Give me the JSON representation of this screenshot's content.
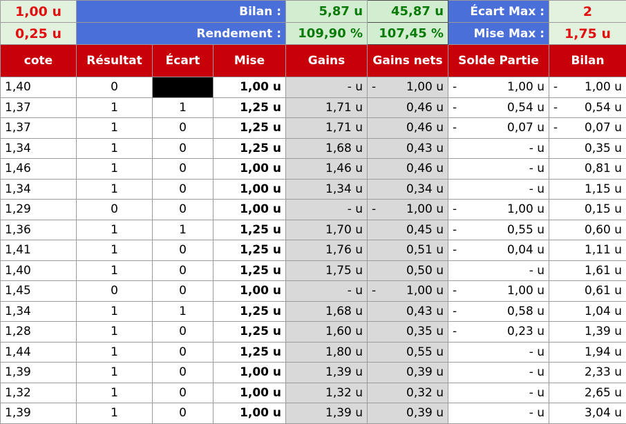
{
  "summary": {
    "left_top": "1,00 u",
    "left_bottom": "0,25 u",
    "bilan_label": "Bilan :",
    "rendement_label": "Rendement :",
    "bilan_value1": "5,87 u",
    "bilan_value2": "45,87 u",
    "rendement_value1": "109,90 %",
    "rendement_value2": "107,45 %",
    "ecart_max_label": "Écart Max :",
    "mise_max_label": "Mise Max :",
    "ecart_max_value": "2",
    "mise_max_value": "1,75 u"
  },
  "headers": [
    "cote",
    "Résultat",
    "Écart",
    "Mise",
    "Gains",
    "Gains nets",
    "Solde Partie",
    "Bilan"
  ],
  "rows": [
    {
      "cote": "1,40",
      "res": "0",
      "ecart": "",
      "mise": "1,00 u",
      "gains": "- u",
      "gn_sign": "-",
      "gn": "1,00 u",
      "sp_sign": "-",
      "sp": "1,00 u",
      "b_sign": "-",
      "bilan": "1,00 u"
    },
    {
      "cote": "1,37",
      "res": "1",
      "ecart": "1",
      "mise": "1,25 u",
      "gains": "1,71 u",
      "gn_sign": "",
      "gn": "0,46 u",
      "sp_sign": "-",
      "sp": "0,54 u",
      "b_sign": "-",
      "bilan": "0,54 u"
    },
    {
      "cote": "1,37",
      "res": "1",
      "ecart": "0",
      "mise": "1,25 u",
      "gains": "1,71 u",
      "gn_sign": "",
      "gn": "0,46 u",
      "sp_sign": "-",
      "sp": "0,07 u",
      "b_sign": "-",
      "bilan": "0,07 u"
    },
    {
      "cote": "1,34",
      "res": "1",
      "ecart": "0",
      "mise": "1,25 u",
      "gains": "1,68 u",
      "gn_sign": "",
      "gn": "0,43 u",
      "sp_sign": "",
      "sp": "- u",
      "b_sign": "",
      "bilan": "0,35 u"
    },
    {
      "cote": "1,46",
      "res": "1",
      "ecart": "0",
      "mise": "1,00 u",
      "gains": "1,46 u",
      "gn_sign": "",
      "gn": "0,46 u",
      "sp_sign": "",
      "sp": "- u",
      "b_sign": "",
      "bilan": "0,81 u"
    },
    {
      "cote": "1,34",
      "res": "1",
      "ecart": "0",
      "mise": "1,00 u",
      "gains": "1,34 u",
      "gn_sign": "",
      "gn": "0,34 u",
      "sp_sign": "",
      "sp": "- u",
      "b_sign": "",
      "bilan": "1,15 u"
    },
    {
      "cote": "1,29",
      "res": "0",
      "ecart": "0",
      "mise": "1,00 u",
      "gains": "- u",
      "gn_sign": "-",
      "gn": "1,00 u",
      "sp_sign": "-",
      "sp": "1,00 u",
      "b_sign": "",
      "bilan": "0,15 u"
    },
    {
      "cote": "1,36",
      "res": "1",
      "ecart": "1",
      "mise": "1,25 u",
      "gains": "1,70 u",
      "gn_sign": "",
      "gn": "0,45 u",
      "sp_sign": "-",
      "sp": "0,55 u",
      "b_sign": "",
      "bilan": "0,60 u"
    },
    {
      "cote": "1,41",
      "res": "1",
      "ecart": "0",
      "mise": "1,25 u",
      "gains": "1,76 u",
      "gn_sign": "",
      "gn": "0,51 u",
      "sp_sign": "-",
      "sp": "0,04 u",
      "b_sign": "",
      "bilan": "1,11 u"
    },
    {
      "cote": "1,40",
      "res": "1",
      "ecart": "0",
      "mise": "1,25 u",
      "gains": "1,75 u",
      "gn_sign": "",
      "gn": "0,50 u",
      "sp_sign": "",
      "sp": "- u",
      "b_sign": "",
      "bilan": "1,61 u"
    },
    {
      "cote": "1,45",
      "res": "0",
      "ecart": "0",
      "mise": "1,00 u",
      "gains": "- u",
      "gn_sign": "-",
      "gn": "1,00 u",
      "sp_sign": "-",
      "sp": "1,00 u",
      "b_sign": "",
      "bilan": "0,61 u"
    },
    {
      "cote": "1,34",
      "res": "1",
      "ecart": "1",
      "mise": "1,25 u",
      "gains": "1,68 u",
      "gn_sign": "",
      "gn": "0,43 u",
      "sp_sign": "-",
      "sp": "0,58 u",
      "b_sign": "",
      "bilan": "1,04 u"
    },
    {
      "cote": "1,28",
      "res": "1",
      "ecart": "0",
      "mise": "1,25 u",
      "gains": "1,60 u",
      "gn_sign": "",
      "gn": "0,35 u",
      "sp_sign": "-",
      "sp": "0,23 u",
      "b_sign": "",
      "bilan": "1,39 u"
    },
    {
      "cote": "1,44",
      "res": "1",
      "ecart": "0",
      "mise": "1,25 u",
      "gains": "1,80 u",
      "gn_sign": "",
      "gn": "0,55 u",
      "sp_sign": "",
      "sp": "- u",
      "b_sign": "",
      "bilan": "1,94 u"
    },
    {
      "cote": "1,39",
      "res": "1",
      "ecart": "0",
      "mise": "1,00 u",
      "gains": "1,39 u",
      "gn_sign": "",
      "gn": "0,39 u",
      "sp_sign": "",
      "sp": "- u",
      "b_sign": "",
      "bilan": "2,33 u"
    },
    {
      "cote": "1,32",
      "res": "1",
      "ecart": "0",
      "mise": "1,00 u",
      "gains": "1,32 u",
      "gn_sign": "",
      "gn": "0,32 u",
      "sp_sign": "",
      "sp": "- u",
      "b_sign": "",
      "bilan": "2,65 u"
    },
    {
      "cote": "1,39",
      "res": "1",
      "ecart": "0",
      "mise": "1,00 u",
      "gains": "1,39 u",
      "gn_sign": "",
      "gn": "0,39 u",
      "sp_sign": "",
      "sp": "- u",
      "b_sign": "",
      "bilan": "3,04 u"
    }
  ],
  "colors": {
    "header_red": "#c8000a",
    "summary_blue": "#4a6fd9",
    "summary_green": "#d3edd0",
    "value_red": "#e01010",
    "value_green": "#0a7a0a",
    "gray_fill": "#d9d9d9"
  }
}
